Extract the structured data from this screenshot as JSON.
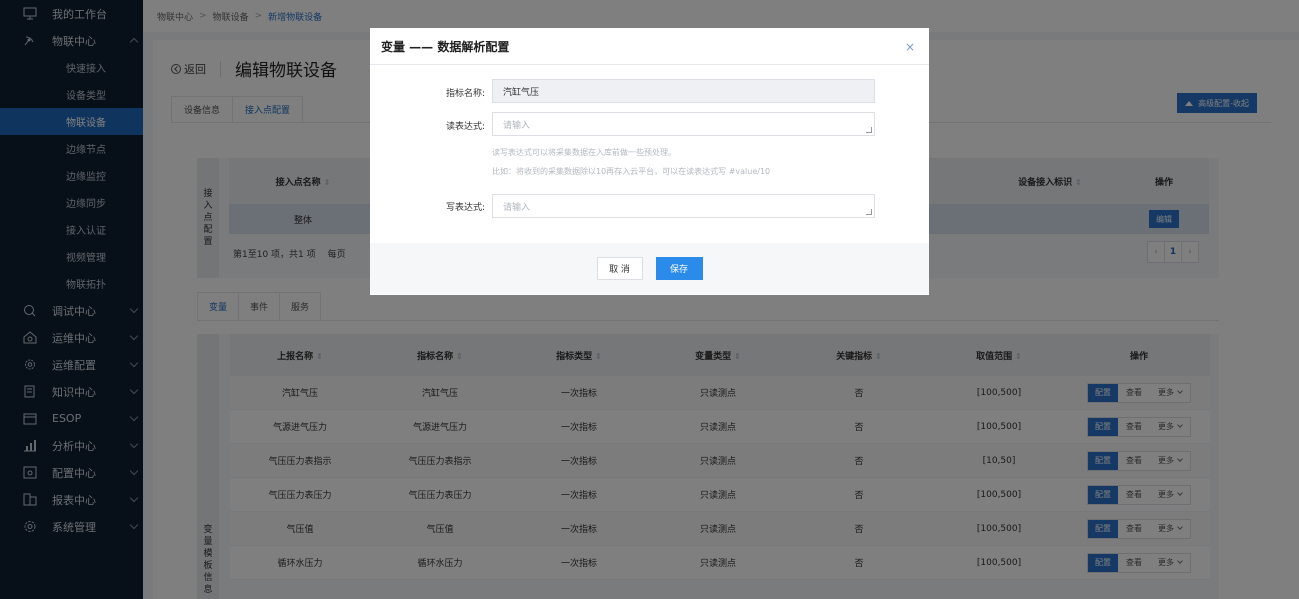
{
  "sidebar": {
    "items": [
      {
        "label": "我的工作台",
        "icon": "monitor-icon",
        "children": []
      },
      {
        "label": "物联中心",
        "icon": "satellite-icon",
        "expanded": true,
        "children": [
          "快速接入",
          "设备类型",
          "物联设备",
          "边缘节点",
          "边缘监控",
          "边缘同步",
          "接入认证",
          "视频管理",
          "物联拓扑"
        ],
        "active_child": "物联设备"
      },
      {
        "label": "调试中心",
        "icon": "debug-icon",
        "children": []
      },
      {
        "label": "运维中心",
        "icon": "home-gear-icon",
        "children": []
      },
      {
        "label": "运维配置",
        "icon": "gear-icon",
        "children": []
      },
      {
        "label": "知识中心",
        "icon": "book-icon",
        "children": []
      },
      {
        "label": "ESOP",
        "icon": "esop-icon",
        "children": []
      },
      {
        "label": "分析中心",
        "icon": "bar-chart-icon",
        "children": []
      },
      {
        "label": "配置中心",
        "icon": "config-icon",
        "children": []
      },
      {
        "label": "报表中心",
        "icon": "report-icon",
        "children": []
      },
      {
        "label": "系统管理",
        "icon": "settings-icon",
        "children": []
      }
    ]
  },
  "breadcrumb": [
    "物联中心",
    "物联设备",
    "新增物联设备"
  ],
  "page": {
    "back_label": "返回",
    "title": "编辑物联设备",
    "tabs": [
      "设备信息",
      "接入点配置"
    ],
    "active_tab": "接入点配置",
    "advanced_button": "高级配置-收起"
  },
  "access_point": {
    "side_label": "接入点配置",
    "columns": [
      "接入点名称",
      "设备接入标识",
      "操作"
    ],
    "row": {
      "name": "整体",
      "action": "编辑"
    },
    "footer_text": "第1至10 项，共1 项",
    "footer_per_page": "每页",
    "current_page": "1"
  },
  "var_tabs": [
    "变量",
    "事件",
    "服务"
  ],
  "active_var_tab": "变量",
  "variables": {
    "side_label": "变量模板信息",
    "columns": [
      "上报名称",
      "指标名称",
      "指标类型",
      "变量类型",
      "关键指标",
      "取值范围",
      "操作"
    ],
    "rows": [
      [
        "汽缸气压",
        "汽缸气压",
        "一次指标",
        "只读测点",
        "否",
        "[100,500]"
      ],
      [
        "气源进气压力",
        "气源进气压力",
        "一次指标",
        "只读测点",
        "否",
        "[100,500]"
      ],
      [
        "气压压力表指示",
        "气压压力表指示",
        "一次指标",
        "只读测点",
        "否",
        "[10,50]"
      ],
      [
        "气压压力表压力",
        "气压压力表压力",
        "一次指标",
        "只读测点",
        "否",
        "[100,500]"
      ],
      [
        "气压值",
        "气压值",
        "一次指标",
        "只读测点",
        "否",
        "[100,500]"
      ],
      [
        "循环水压力",
        "循环水压力",
        "一次指标",
        "只读测点",
        "否",
        "[100,500]"
      ]
    ],
    "op_labels": {
      "config": "配置",
      "view": "查看",
      "more": "更多"
    }
  },
  "modal": {
    "title": "变量 —— 数据解析配置",
    "close": "×",
    "metric_label": "指标名称:",
    "metric_value": "汽缸气压",
    "read_label": "读表达式:",
    "read_placeholder": "请输入",
    "hint1": "读写表达式可以将采集数据在入库前做一些预处理。",
    "hint2": "比如：将收到的采集数据除以10再存入云平台，可以在读表达式写 #value/10",
    "write_label": "写表达式:",
    "write_placeholder": "请输入",
    "cancel": "取 消",
    "save": "保存"
  }
}
